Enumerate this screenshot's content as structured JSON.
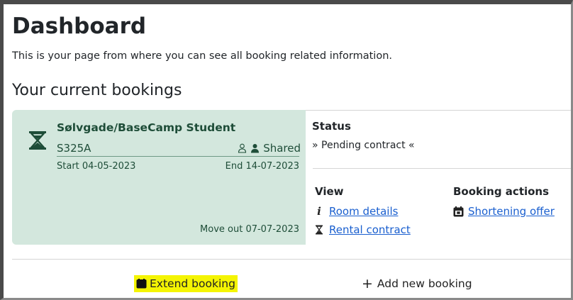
{
  "header": {
    "title": "Dashboard",
    "description": "This is your page from where you can see all booking related information."
  },
  "bookings": {
    "section_title": "Your current bookings",
    "items": [
      {
        "property": "Sølvgade/BaseCamp Student",
        "room": "S325A",
        "room_type": "Shared",
        "start": "Start 04-05-2023",
        "end": "End 14-07-2023",
        "move_out": "Move out 07-07-2023",
        "status_label": "Status",
        "status_value": "» Pending contract «",
        "view_label": "View",
        "view_links": [
          "Room details",
          "Rental contract"
        ],
        "actions_label": "Booking actions",
        "action_links": [
          "Shortening offer"
        ],
        "status_icon": "hourglass-icon"
      }
    ]
  },
  "footer": {
    "extend_label": "Extend booking",
    "add_label": "Add new booking"
  },
  "colors": {
    "card_bg": "#d3e7dd",
    "card_text": "#1e4d38",
    "link": "#1a5fcf",
    "highlight": "#f4f403"
  }
}
